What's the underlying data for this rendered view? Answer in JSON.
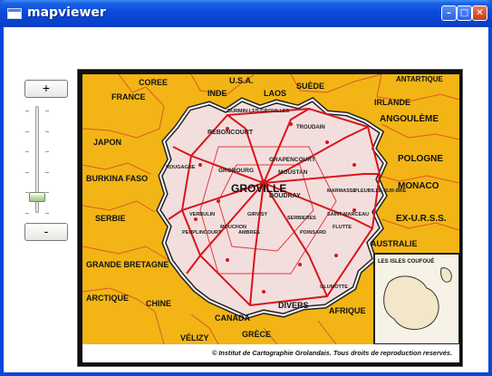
{
  "window": {
    "title": "mapviewer",
    "buttons": {
      "minimize": "minimize-icon",
      "maximize": "maximize-icon",
      "close": "close-icon"
    }
  },
  "zoom": {
    "zoom_in_label": "+",
    "zoom_out_label": "-",
    "slider_level": 0.1
  },
  "map": {
    "center_label": "GROVILLE",
    "regions": [
      "COREE",
      "U.S.A.",
      "INDE",
      "LAOS",
      "SUÈDE",
      "ANTARTIQUE",
      "FRANCE",
      "IRLANDE",
      "ANGOULÈME",
      "JAPON",
      "POLOGNE",
      "BURKINA FASO",
      "MONACO",
      "SERBIE",
      "EX-U.R.S.S.",
      "AUSTRALIE",
      "GRANDE BRETAGNE",
      "ARCTIQUE",
      "CHINE",
      "CANADA",
      "DIVERS",
      "AFRIQUE",
      "VÉLIZY",
      "GRÈCE"
    ],
    "towns": [
      "BURMIN-LES-GROVILLES",
      "REBONCOURT",
      "TROUDAIN",
      "GRAPENCOURT",
      "GROBOURG",
      "MOUSTAN",
      "DOUDRAY",
      "ROUGAGNE",
      "MARMASSE",
      "PLEUBILLE-SUR-BRE",
      "VERBULIN",
      "PEUPLINCOURT",
      "GIRVISY",
      "POINSARD",
      "SERBIERES",
      "FLUTTE",
      "OLUMOTTE",
      "SAINT-MARCEAU",
      "MOUCHON",
      "AMBRES"
    ],
    "inset_label": "LES ISLES COUFOUÉ"
  },
  "caption": "© Institut de Cartographie Grolandais. Tous droits de reproduction reservés.",
  "colors": {
    "map_yellow": "#f2b515",
    "map_pink": "#f3dede",
    "road_red": "#d8151b",
    "border_red": "#e0402a",
    "titlebar_blue": "#0a4ad9"
  }
}
